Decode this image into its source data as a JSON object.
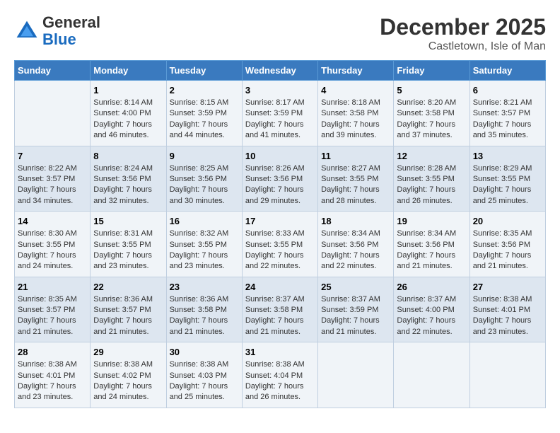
{
  "logo": {
    "general": "General",
    "blue": "Blue"
  },
  "title": "December 2025",
  "subtitle": "Castletown, Isle of Man",
  "days_of_week": [
    "Sunday",
    "Monday",
    "Tuesday",
    "Wednesday",
    "Thursday",
    "Friday",
    "Saturday"
  ],
  "weeks": [
    [
      {
        "day": "",
        "info": ""
      },
      {
        "day": "1",
        "info": "Sunrise: 8:14 AM\nSunset: 4:00 PM\nDaylight: 7 hours\nand 46 minutes."
      },
      {
        "day": "2",
        "info": "Sunrise: 8:15 AM\nSunset: 3:59 PM\nDaylight: 7 hours\nand 44 minutes."
      },
      {
        "day": "3",
        "info": "Sunrise: 8:17 AM\nSunset: 3:59 PM\nDaylight: 7 hours\nand 41 minutes."
      },
      {
        "day": "4",
        "info": "Sunrise: 8:18 AM\nSunset: 3:58 PM\nDaylight: 7 hours\nand 39 minutes."
      },
      {
        "day": "5",
        "info": "Sunrise: 8:20 AM\nSunset: 3:58 PM\nDaylight: 7 hours\nand 37 minutes."
      },
      {
        "day": "6",
        "info": "Sunrise: 8:21 AM\nSunset: 3:57 PM\nDaylight: 7 hours\nand 35 minutes."
      }
    ],
    [
      {
        "day": "7",
        "info": "Sunrise: 8:22 AM\nSunset: 3:57 PM\nDaylight: 7 hours\nand 34 minutes."
      },
      {
        "day": "8",
        "info": "Sunrise: 8:24 AM\nSunset: 3:56 PM\nDaylight: 7 hours\nand 32 minutes."
      },
      {
        "day": "9",
        "info": "Sunrise: 8:25 AM\nSunset: 3:56 PM\nDaylight: 7 hours\nand 30 minutes."
      },
      {
        "day": "10",
        "info": "Sunrise: 8:26 AM\nSunset: 3:56 PM\nDaylight: 7 hours\nand 29 minutes."
      },
      {
        "day": "11",
        "info": "Sunrise: 8:27 AM\nSunset: 3:55 PM\nDaylight: 7 hours\nand 28 minutes."
      },
      {
        "day": "12",
        "info": "Sunrise: 8:28 AM\nSunset: 3:55 PM\nDaylight: 7 hours\nand 26 minutes."
      },
      {
        "day": "13",
        "info": "Sunrise: 8:29 AM\nSunset: 3:55 PM\nDaylight: 7 hours\nand 25 minutes."
      }
    ],
    [
      {
        "day": "14",
        "info": "Sunrise: 8:30 AM\nSunset: 3:55 PM\nDaylight: 7 hours\nand 24 minutes."
      },
      {
        "day": "15",
        "info": "Sunrise: 8:31 AM\nSunset: 3:55 PM\nDaylight: 7 hours\nand 23 minutes."
      },
      {
        "day": "16",
        "info": "Sunrise: 8:32 AM\nSunset: 3:55 PM\nDaylight: 7 hours\nand 23 minutes."
      },
      {
        "day": "17",
        "info": "Sunrise: 8:33 AM\nSunset: 3:55 PM\nDaylight: 7 hours\nand 22 minutes."
      },
      {
        "day": "18",
        "info": "Sunrise: 8:34 AM\nSunset: 3:56 PM\nDaylight: 7 hours\nand 22 minutes."
      },
      {
        "day": "19",
        "info": "Sunrise: 8:34 AM\nSunset: 3:56 PM\nDaylight: 7 hours\nand 21 minutes."
      },
      {
        "day": "20",
        "info": "Sunrise: 8:35 AM\nSunset: 3:56 PM\nDaylight: 7 hours\nand 21 minutes."
      }
    ],
    [
      {
        "day": "21",
        "info": "Sunrise: 8:35 AM\nSunset: 3:57 PM\nDaylight: 7 hours\nand 21 minutes."
      },
      {
        "day": "22",
        "info": "Sunrise: 8:36 AM\nSunset: 3:57 PM\nDaylight: 7 hours\nand 21 minutes."
      },
      {
        "day": "23",
        "info": "Sunrise: 8:36 AM\nSunset: 3:58 PM\nDaylight: 7 hours\nand 21 minutes."
      },
      {
        "day": "24",
        "info": "Sunrise: 8:37 AM\nSunset: 3:58 PM\nDaylight: 7 hours\nand 21 minutes."
      },
      {
        "day": "25",
        "info": "Sunrise: 8:37 AM\nSunset: 3:59 PM\nDaylight: 7 hours\nand 21 minutes."
      },
      {
        "day": "26",
        "info": "Sunrise: 8:37 AM\nSunset: 4:00 PM\nDaylight: 7 hours\nand 22 minutes."
      },
      {
        "day": "27",
        "info": "Sunrise: 8:38 AM\nSunset: 4:01 PM\nDaylight: 7 hours\nand 23 minutes."
      }
    ],
    [
      {
        "day": "28",
        "info": "Sunrise: 8:38 AM\nSunset: 4:01 PM\nDaylight: 7 hours\nand 23 minutes."
      },
      {
        "day": "29",
        "info": "Sunrise: 8:38 AM\nSunset: 4:02 PM\nDaylight: 7 hours\nand 24 minutes."
      },
      {
        "day": "30",
        "info": "Sunrise: 8:38 AM\nSunset: 4:03 PM\nDaylight: 7 hours\nand 25 minutes."
      },
      {
        "day": "31",
        "info": "Sunrise: 8:38 AM\nSunset: 4:04 PM\nDaylight: 7 hours\nand 26 minutes."
      },
      {
        "day": "",
        "info": ""
      },
      {
        "day": "",
        "info": ""
      },
      {
        "day": "",
        "info": ""
      }
    ]
  ]
}
